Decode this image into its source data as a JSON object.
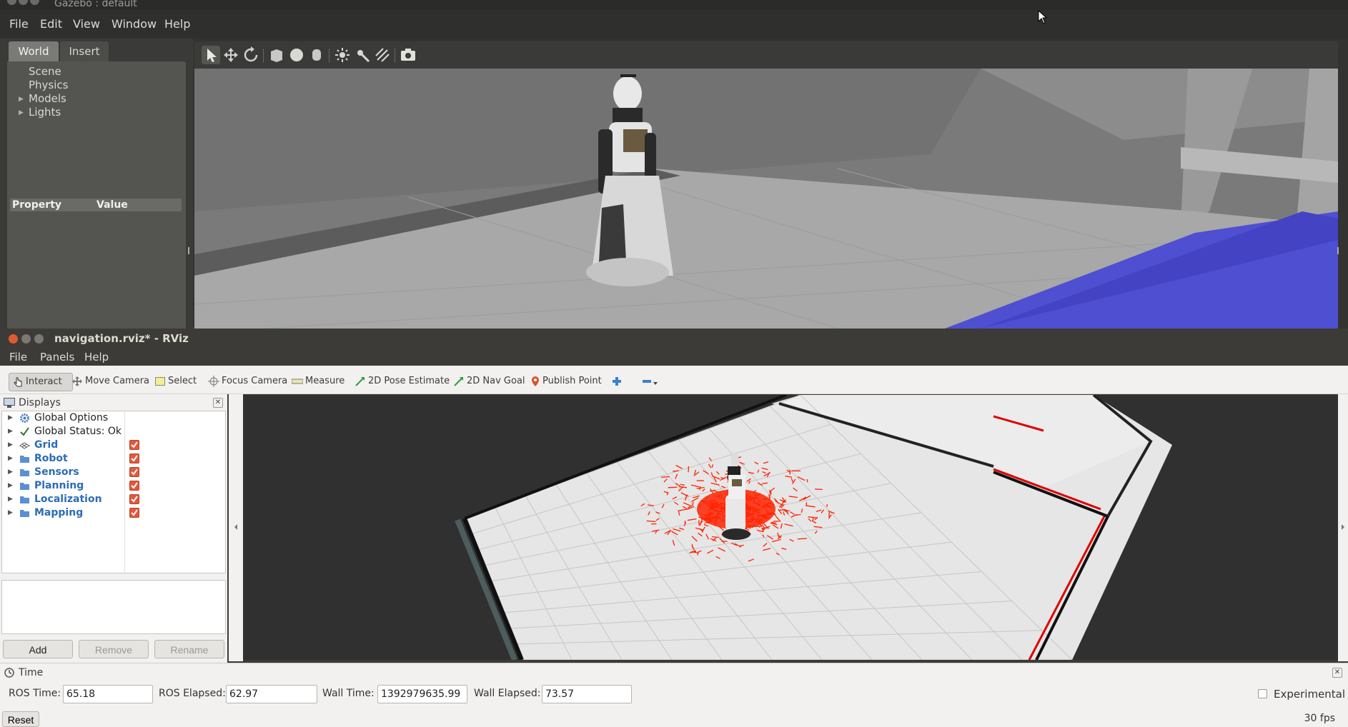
{
  "gazebo": {
    "title": "Gazebo : default",
    "menu": [
      "File",
      "Edit",
      "View",
      "Window",
      "Help"
    ],
    "tabs": [
      "World",
      "Insert"
    ],
    "tree": [
      "Scene",
      "Physics",
      "Models",
      "Lights"
    ],
    "property_header": "Property",
    "value_header": "Value"
  },
  "rviz": {
    "title": "navigation.rviz* - RViz",
    "menu": [
      "File",
      "Panels",
      "Help"
    ],
    "toolbar": {
      "interact": "Interact",
      "move_camera": "Move Camera",
      "select": "Select",
      "focus_camera": "Focus Camera",
      "measure": "Measure",
      "pose_estimate": "2D Pose Estimate",
      "nav_goal": "2D Nav Goal",
      "publish_point": "Publish Point"
    },
    "displays_title": "Displays",
    "displays": [
      {
        "label": "Global Options",
        "checked": false
      },
      {
        "label": "Global Status: Ok",
        "checked": false
      },
      {
        "label": "Grid",
        "checked": true
      },
      {
        "label": "Robot",
        "checked": true
      },
      {
        "label": "Sensors",
        "checked": true
      },
      {
        "label": "Planning",
        "checked": true
      },
      {
        "label": "Localization",
        "checked": true
      },
      {
        "label": "Mapping",
        "checked": true
      }
    ],
    "buttons": {
      "add": "Add",
      "remove": "Remove",
      "rename": "Rename"
    },
    "time_panel": {
      "title": "Time",
      "ros_time_label": "ROS Time:",
      "ros_time": "65.18",
      "ros_elapsed_label": "ROS Elapsed:",
      "ros_elapsed": "62.97",
      "wall_time_label": "Wall Time:",
      "wall_time": "1392979635.99",
      "wall_elapsed_label": "Wall Elapsed:",
      "wall_elapsed": "73.57",
      "experimental": "Experimental",
      "reset": "Reset",
      "fps": "30 fps"
    }
  },
  "colors": {
    "checkbox": "#e4583a",
    "display_blue": "#2b6cb7",
    "particles": "#ff2200",
    "gazebo_floor_blue": "#4c4cd0"
  }
}
